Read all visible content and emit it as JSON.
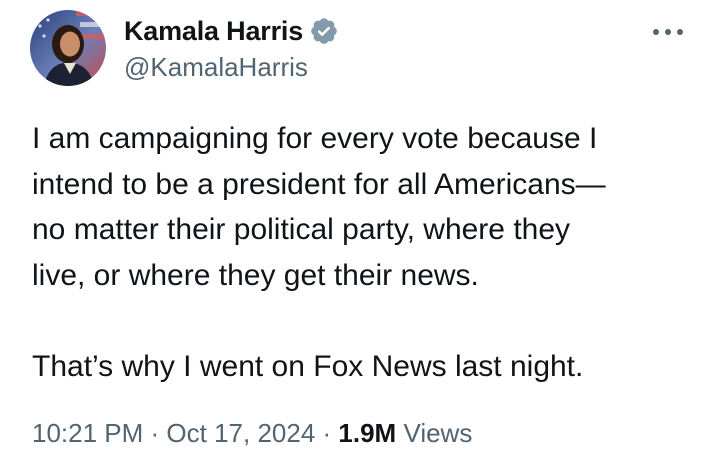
{
  "author": {
    "display_name": "Kamala Harris",
    "handle": "@KamalaHarris",
    "verified_icon": "verified-badge-icon",
    "verified_color": "#1d9bf0"
  },
  "header": {
    "more_icon": "more-horizontal-icon"
  },
  "tweet": {
    "paragraph_1": [
      "I am campaigning for every vote because I",
      "intend to be a president for all Americans—",
      "no matter their political party, where they",
      "live, or where they get their news."
    ],
    "paragraph_2": "That’s why I went on Fox News last night."
  },
  "meta": {
    "time": "10:21 PM",
    "separator_1": " · ",
    "date": "Oct 17, 2024",
    "separator_2": " · ",
    "views_count": "1.9M",
    "views_label": " Views"
  },
  "colors": {
    "text_primary": "#0f1419",
    "text_secondary": "#536471",
    "background": "#ffffff"
  }
}
